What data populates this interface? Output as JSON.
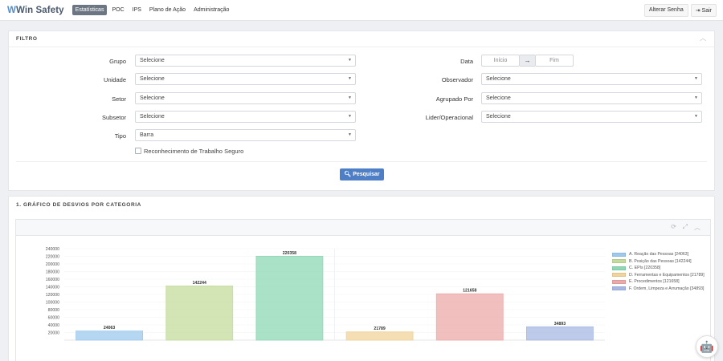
{
  "brand": {
    "name": "Win Safety"
  },
  "nav": [
    {
      "label": "Estatísticas",
      "active": true
    },
    {
      "label": "POC"
    },
    {
      "label": "IPS"
    },
    {
      "label": "Plano de Ação"
    },
    {
      "label": "Administração"
    }
  ],
  "topRight": {
    "change_password": "Alterar Senha",
    "logout": "Sair"
  },
  "filter": {
    "title": "FILTRO",
    "grupo": {
      "label": "Grupo",
      "value": "Selecione"
    },
    "unidade": {
      "label": "Unidade",
      "value": "Selecione"
    },
    "setor": {
      "label": "Setor",
      "value": "Selecione"
    },
    "subsetor": {
      "label": "Subsetor",
      "value": "Selecione"
    },
    "tipo": {
      "label": "Tipo",
      "value": "Barra"
    },
    "data": {
      "label": "Data",
      "start_placeholder": "Início",
      "end_placeholder": "Fim"
    },
    "observador": {
      "label": "Observador",
      "value": "Selecione"
    },
    "agrupado": {
      "label": "Agrupado Por",
      "value": "Selecione"
    },
    "lider": {
      "label": "Lider/Operacional",
      "value": "Selecione"
    },
    "checkbox_label": "Reconhecimento de Trabalho Seguro",
    "search_label": "Pesquisar"
  },
  "chart_section": {
    "title": "1. GRÁFICO DE DESVIOS POR CATEGORIA"
  },
  "chart_data": {
    "type": "bar",
    "categories": [
      "A. Reação das Pessoas [24063]",
      "B. Posição das Pessoas [142244]",
      "C. EPIs [220358]",
      "D. Ferramentas e Equipamentos [21789]",
      "E. Procedimentos [121658]",
      "F. Ordem, Limpeza e Arrumação [34893]"
    ],
    "values": [
      24063,
      142244,
      220358,
      21789,
      121658,
      34893
    ],
    "value_labels": [
      "24063",
      "142244",
      "220358",
      "21789",
      "121658",
      "34893"
    ],
    "colors": [
      "#9ec9ee",
      "#c4dc9b",
      "#8ed8b4",
      "#f2d39a",
      "#eda9a9",
      "#a7b8e3"
    ],
    "y_ticks": [
      "240000",
      "220000",
      "200000",
      "180000",
      "160000",
      "140000",
      "120000",
      "100000",
      "80000",
      "60000",
      "40000",
      "20000"
    ],
    "ylim": [
      0,
      240000
    ],
    "legend_position": "right"
  }
}
